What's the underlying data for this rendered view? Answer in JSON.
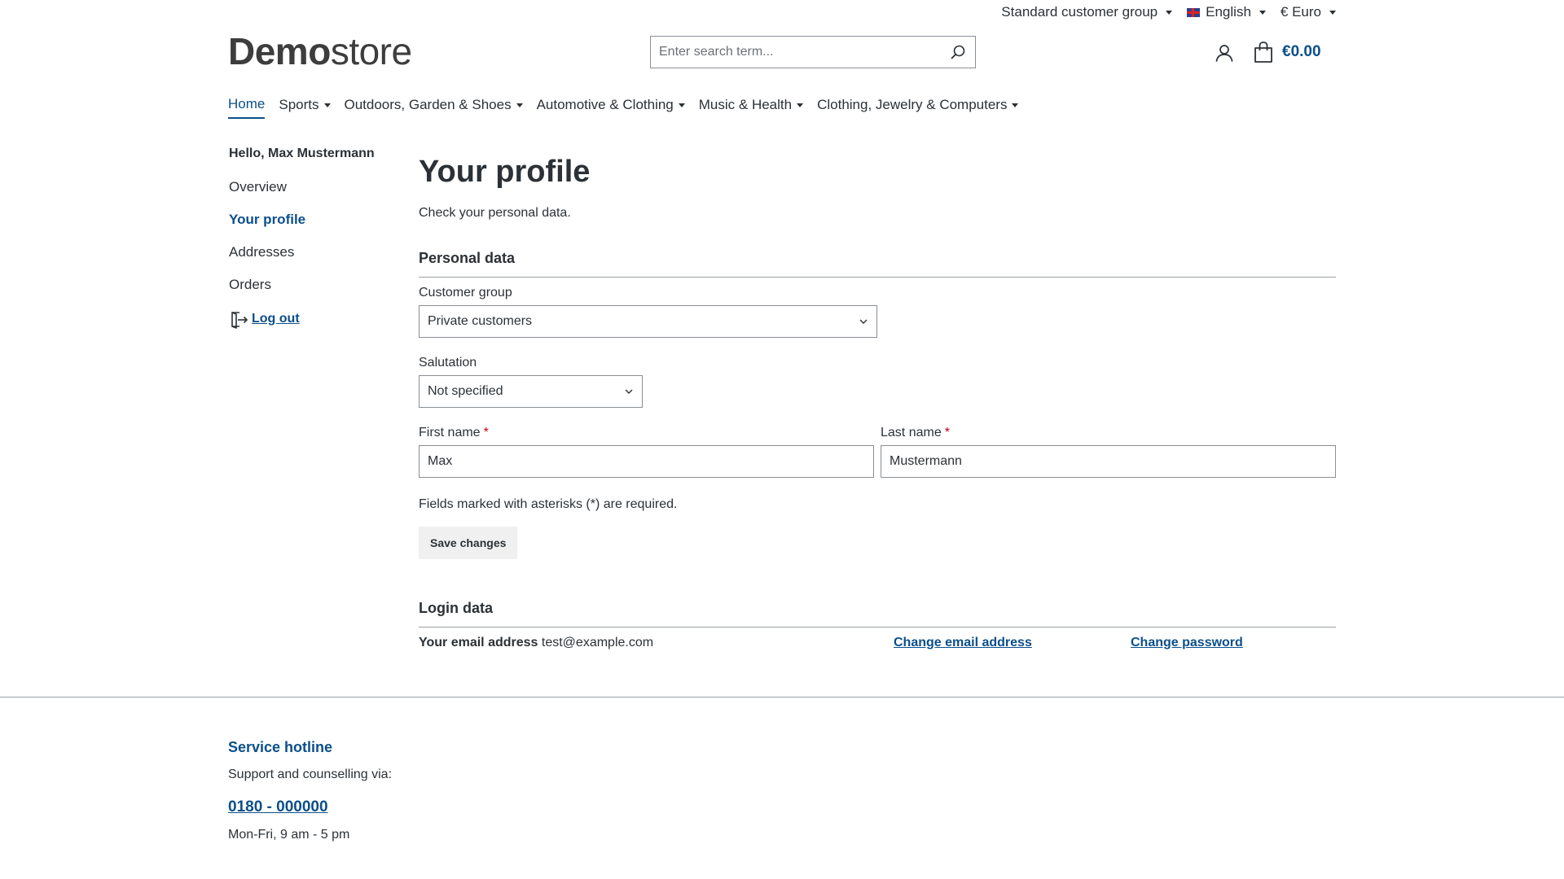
{
  "topbar": {
    "customer_group": "Standard customer group",
    "language": "English",
    "currency": "€ Euro"
  },
  "header": {
    "logo_bold": "Demo",
    "logo_light": "store",
    "search_placeholder": "Enter search term...",
    "cart_amount": "€0.00"
  },
  "nav": {
    "items": [
      {
        "label": "Home"
      },
      {
        "label": "Sports"
      },
      {
        "label": "Outdoors, Garden & Shoes"
      },
      {
        "label": "Automotive & Clothing"
      },
      {
        "label": "Music & Health"
      },
      {
        "label": "Clothing, Jewelry & Computers"
      }
    ]
  },
  "sidebar": {
    "greeting": "Hello, Max Mustermann",
    "links": [
      {
        "label": "Overview"
      },
      {
        "label": "Your profile"
      },
      {
        "label": "Addresses"
      },
      {
        "label": "Orders"
      }
    ],
    "logout": "Log out"
  },
  "main": {
    "title": "Your profile",
    "subtitle": "Check your personal data.",
    "personal_data": {
      "heading": "Personal data",
      "customer_group_label": "Customer group",
      "customer_group_value": "Private customers",
      "salutation_label": "Salutation",
      "salutation_value": "Not specified",
      "first_name_label": "First name",
      "first_name_value": "Max",
      "last_name_label": "Last name",
      "last_name_value": "Mustermann",
      "required_marker": "*",
      "required_note": "Fields marked with asterisks (*) are required.",
      "save_label": "Save changes"
    },
    "login_data": {
      "heading": "Login data",
      "email_label": "Your email address",
      "email_value": "test@example.com",
      "change_email": "Change email address",
      "change_password": "Change password"
    }
  },
  "footer": {
    "heading": "Service hotline",
    "text": "Support and counselling via:",
    "phone": "0180 - 000000",
    "hours": "Mon-Fri, 9 am - 5 pm"
  },
  "colors": {
    "accent": "#0b4f8a",
    "required": "#c20017",
    "text": "#2b3136"
  }
}
